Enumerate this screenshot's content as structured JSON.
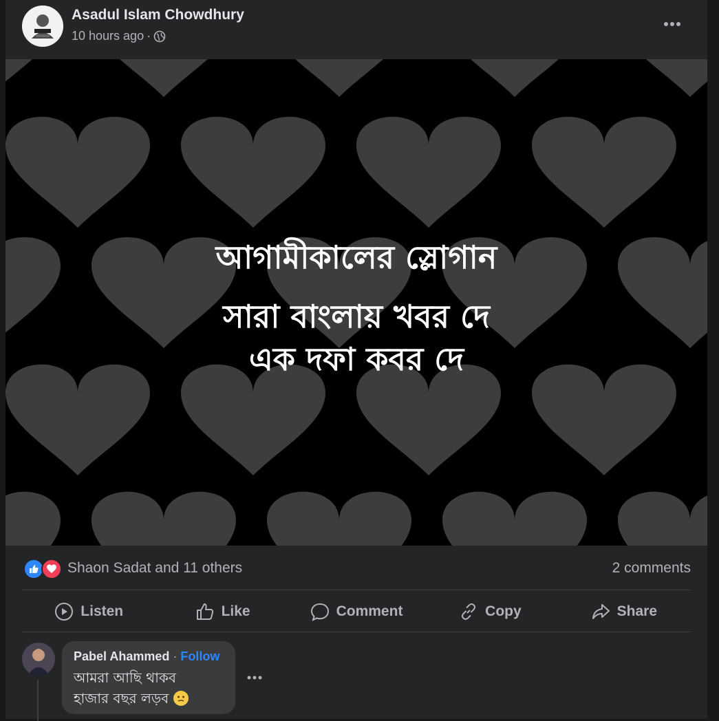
{
  "post": {
    "author": "Asadul Islam Chowdhury",
    "time": "10 hours ago",
    "separator": "·",
    "privacy_icon": "globe-icon",
    "more_icon": "more-horizontal-icon"
  },
  "media": {
    "line1": "আগামীকালের স্লোগান",
    "line2": "সারা বাংলায় খবর দে",
    "line3": "এক দফা কবর দে",
    "background_color": "#000000",
    "pattern_color": "#3d3d3d"
  },
  "reactions": {
    "icons": [
      "like-icon",
      "love-icon"
    ],
    "names": "Shaon Sadat and 11 others",
    "comments": "2 comments",
    "like_color": "#2d88ff",
    "love_color": "#f33e58"
  },
  "actions": [
    {
      "label": "Listen",
      "icon": "play-circle-icon"
    },
    {
      "label": "Like",
      "icon": "thumbs-up-icon"
    },
    {
      "label": "Comment",
      "icon": "comment-icon"
    },
    {
      "label": "Copy",
      "icon": "link-icon"
    },
    {
      "label": "Share",
      "icon": "share-icon"
    }
  ],
  "comment": {
    "author": "Pabel Ahammed",
    "dot": "·",
    "follow": "Follow",
    "line1": "আমরা আছি থাকব",
    "line2": "হাজার বছর লড়ব",
    "emoji": "thinking-face-emoji"
  }
}
